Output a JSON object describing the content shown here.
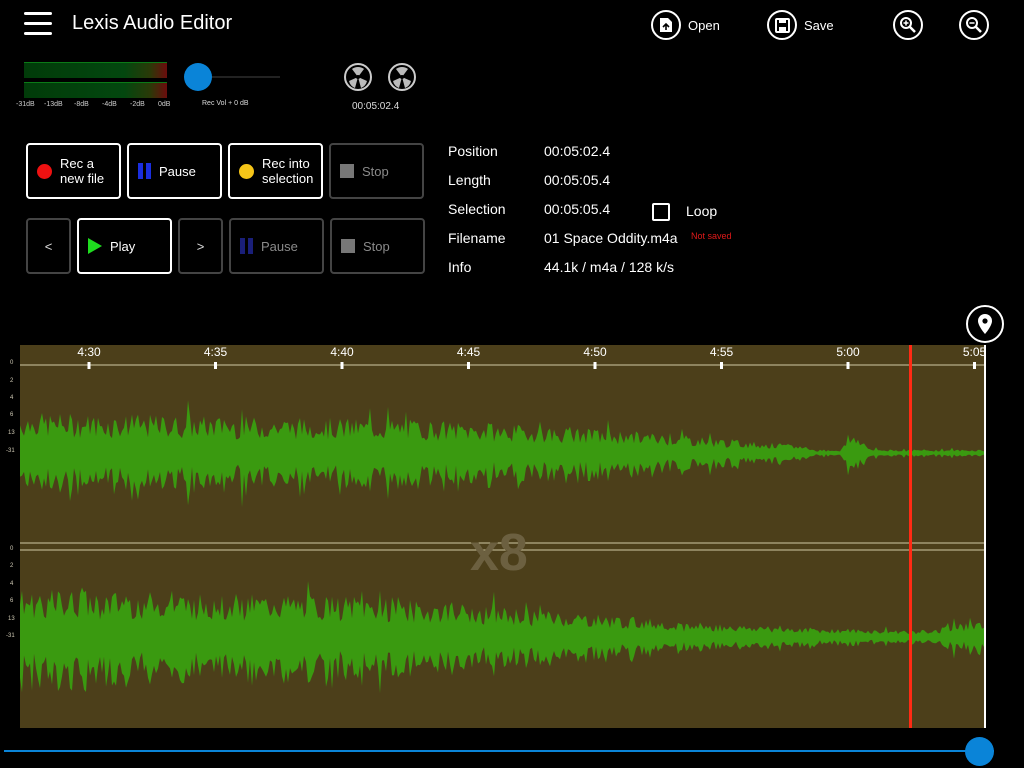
{
  "app": {
    "title": "Lexis Audio Editor"
  },
  "header": {
    "open_label": "Open",
    "save_label": "Save"
  },
  "meters": {
    "scale": [
      "-31dB",
      "-13dB",
      "-8dB",
      "-4dB",
      "-2dB",
      "0dB"
    ],
    "rec_vol_label": "Rec Vol + 0 dB",
    "rec_vol_level": 0.0,
    "reel_time": "00:05:02.4"
  },
  "record": {
    "new_file": [
      "Rec a",
      "new file"
    ],
    "pause": "Pause",
    "into_selection": [
      "Rec into",
      "selection"
    ],
    "stop": "Stop"
  },
  "playback": {
    "prev": "<",
    "play": "Play",
    "next": ">",
    "pause": "Pause",
    "stop": "Stop"
  },
  "info": {
    "position_label": "Position",
    "position": "00:05:02.4",
    "length_label": "Length",
    "length": "00:05:05.4",
    "selection_label": "Selection",
    "selection": "00:05:05.4",
    "loop_label": "Loop",
    "loop_checked": false,
    "filename_label": "Filename",
    "filename": "01 Space Oddity.m4a",
    "not_saved": "Not saved",
    "info_label": "Info",
    "info": "44.1k / m4a / 128 k/s"
  },
  "waveform": {
    "ticks": [
      "4:30",
      "4:35",
      "4:40",
      "4:45",
      "4:50",
      "4:55",
      "5:00",
      "5:05"
    ],
    "db_labels": [
      "0",
      "2",
      "4",
      "6",
      "13",
      "-31"
    ],
    "zoom": "x8",
    "bg_color": "#4c3f1a",
    "wave_color": "#3a9a10",
    "playhead_color": "#ff2a14"
  },
  "colors": {
    "accent": "#0a84d8",
    "rec": "#ee1111",
    "rec_sel": "#f5c518",
    "pause": "#1a2ee0"
  },
  "scroll": {
    "position": 0.98
  }
}
